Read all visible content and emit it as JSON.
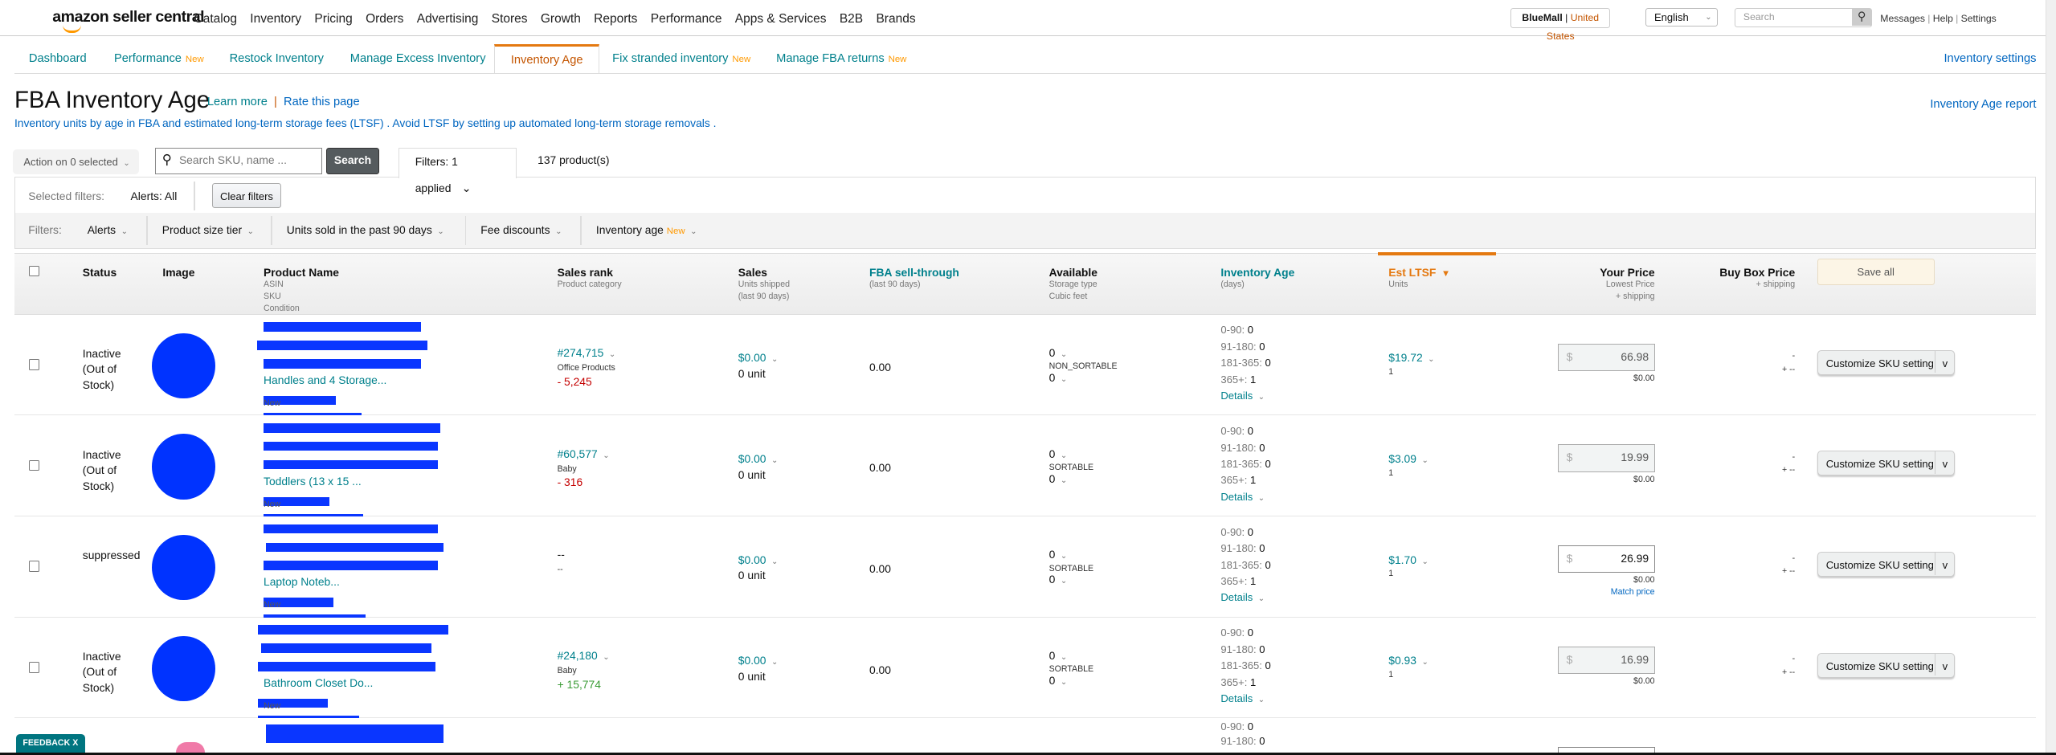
{
  "brand": {
    "logo": "amazon seller central"
  },
  "nav": [
    "Catalog",
    "Inventory",
    "Pricing",
    "Orders",
    "Advertising",
    "Stores",
    "Growth",
    "Reports",
    "Performance",
    "Apps & Services",
    "B2B",
    "Brands"
  ],
  "account": {
    "store": "BlueMall",
    "marketplace": "United States"
  },
  "language": "English",
  "global_search": {
    "placeholder": "Search"
  },
  "top_links": [
    "Messages",
    "Help",
    "Settings"
  ],
  "tabs": [
    {
      "label": "Dashboard",
      "badge": ""
    },
    {
      "label": "Performance",
      "badge": "New"
    },
    {
      "label": "Restock Inventory",
      "badge": ""
    },
    {
      "label": "Manage Excess Inventory",
      "badge": ""
    },
    {
      "label": "Inventory Age",
      "badge": "",
      "active": true
    },
    {
      "label": "Fix stranded inventory",
      "badge": "New"
    },
    {
      "label": "Manage FBA returns",
      "badge": "New"
    }
  ],
  "inventory_settings": "Inventory settings",
  "page": {
    "title": "FBA Inventory Age",
    "learn_more": "Learn more",
    "rate": "Rate this page",
    "subtitle": "Inventory units by age in FBA and estimated long-term storage fees (LTSF) . Avoid LTSF by setting up automated long-term storage removals .",
    "report_link": "Inventory Age report"
  },
  "toolbar": {
    "action": "Action on 0 selected",
    "search_placeholder": "Search SKU, name ...",
    "search_button": "Search",
    "filters_tab": "Filters: 1 applied",
    "count": "137 product(s)"
  },
  "selected_filters": {
    "label": "Selected filters:",
    "value": "Alerts: All",
    "clear": "Clear filters"
  },
  "filters": {
    "label": "Filters:",
    "items": [
      {
        "label": "Alerts",
        "badge": ""
      },
      {
        "label": "Product size tier",
        "badge": ""
      },
      {
        "label": "Units sold in the past 90 days",
        "badge": ""
      },
      {
        "label": "Fee discounts",
        "badge": ""
      },
      {
        "label": "Inventory age",
        "badge": "New"
      }
    ]
  },
  "columns": {
    "status": "Status",
    "image": "Image",
    "product": {
      "title": "Product Name",
      "subs": [
        "ASIN",
        "SKU",
        "Condition"
      ]
    },
    "rank": {
      "title": "Sales rank",
      "subs": [
        "Product category"
      ]
    },
    "sales": {
      "title": "Sales",
      "subs": [
        "Units shipped",
        "(last 90 days)"
      ]
    },
    "sell": {
      "title": "FBA sell-through",
      "subs": [
        "(last 90 days)"
      ]
    },
    "avail": {
      "title": "Available",
      "subs": [
        "Storage type",
        "Cubic feet"
      ]
    },
    "age": {
      "title": "Inventory Age",
      "subs": [
        "(days)"
      ]
    },
    "ltsf": {
      "title": "Est LTSF",
      "subs": [
        "Units"
      ],
      "sort": "▼"
    },
    "price": {
      "title": "Your Price",
      "subs": [
        "Lowest Price",
        "+ shipping"
      ]
    },
    "buybox": {
      "title": "Buy Box Price",
      "subs": [
        "+ shipping"
      ]
    },
    "save_all": "Save all"
  },
  "age_labels": [
    "0-90:",
    "91-180:",
    "181-365:",
    "365+:"
  ],
  "details": "Details",
  "customize": "Customize SKU setting",
  "rows": [
    {
      "status": "Inactive (Out of Stock)",
      "image_color": "#0033ff",
      "name_tail": "Handles and 4 Storage...",
      "condition": "New",
      "rank": "#274,715",
      "category": "Office Products",
      "rank_change": "- 5,245",
      "change_dir": "down",
      "sales": "$0.00",
      "units": "0 unit",
      "sell": "0.00",
      "avail": "0",
      "storage": "NON_SORTABLE",
      "cubic": "0",
      "age": [
        "0",
        "0",
        "0",
        "1"
      ],
      "ltsf": "$19.72",
      "ltsf_units": "1",
      "price": "66.98",
      "price_editable": false,
      "lowest": "$0.00",
      "match": "",
      "buybox": "-",
      "buybox_ship": "+ --"
    },
    {
      "status": "Inactive (Out of Stock)",
      "image_color": "#0033ff",
      "name_tail": "Toddlers (13 x 15 ...",
      "condition": "New",
      "rank": "#60,577",
      "category": "Baby",
      "rank_change": "- 316",
      "change_dir": "down",
      "sales": "$0.00",
      "units": "0 unit",
      "sell": "0.00",
      "avail": "0",
      "storage": "SORTABLE",
      "cubic": "0",
      "age": [
        "0",
        "0",
        "0",
        "1"
      ],
      "ltsf": "$3.09",
      "ltsf_units": "1",
      "price": "19.99",
      "price_editable": false,
      "lowest": "$0.00",
      "match": "",
      "buybox": "-",
      "buybox_ship": "+ --"
    },
    {
      "status": "suppressed",
      "image_color": "#0033ff",
      "name_tail": "Laptop Noteb...",
      "condition": "New",
      "rank": "--",
      "category": "--",
      "rank_change": "",
      "change_dir": "",
      "sales": "$0.00",
      "units": "0 unit",
      "sell": "0.00",
      "avail": "0",
      "storage": "SORTABLE",
      "cubic": "0",
      "age": [
        "0",
        "0",
        "0",
        "1"
      ],
      "ltsf": "$1.70",
      "ltsf_units": "1",
      "price": "26.99",
      "price_editable": true,
      "lowest": "$0.00",
      "match": "Match price",
      "buybox": "-",
      "buybox_ship": "+ --"
    },
    {
      "status": "Inactive (Out of Stock)",
      "image_color": "#0033ff",
      "name_tail": "Bathroom Closet Do...",
      "condition": "New",
      "rank": "#24,180",
      "category": "Baby",
      "rank_change": "+ 15,774",
      "change_dir": "up",
      "sales": "$0.00",
      "units": "0 unit",
      "sell": "0.00",
      "avail": "0",
      "storage": "SORTABLE",
      "cubic": "0",
      "age": [
        "0",
        "0",
        "0",
        "1"
      ],
      "ltsf": "$0.93",
      "ltsf_units": "1",
      "price": "16.99",
      "price_editable": false,
      "lowest": "$0.00",
      "match": "",
      "buybox": "-",
      "buybox_ship": "+ --"
    },
    {
      "status": "",
      "image_color": "#f07aa8",
      "name_tail": "",
      "condition": "",
      "rank": "",
      "category": "",
      "rank_change": "",
      "change_dir": "",
      "sales": "",
      "units": "",
      "sell": "",
      "avail": "",
      "storage": "",
      "cubic": "",
      "age": [
        "0",
        "0"
      ],
      "ltsf": "",
      "ltsf_units": "",
      "price": "",
      "price_editable": true,
      "lowest": "",
      "match": "",
      "buybox": "",
      "buybox_ship": ""
    }
  ],
  "feedback": "FEEDBACK",
  "feedback_close": "X",
  "colors": {
    "accent": "#e47911",
    "teal": "#00808c",
    "link": "#0066c0",
    "redaction": "#0a36ff"
  }
}
